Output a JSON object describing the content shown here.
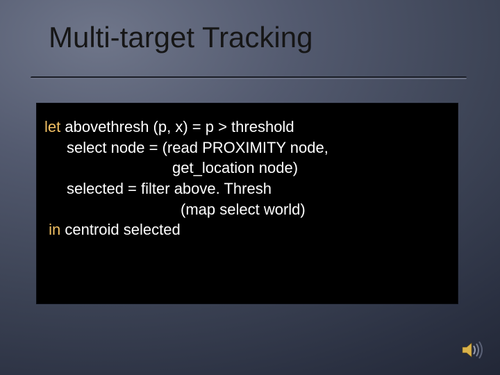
{
  "slide": {
    "title": "Multi-target Tracking",
    "code": {
      "kw_let": "let",
      "kw_in": "in",
      "l1_rest": " abovethresh (p, x) = p > threshold",
      "l2": "select node = (read PROXIMITY node,",
      "l3": "get_location node)",
      "l4": "selected = filter above. Thresh",
      "l5": "(map select world)",
      "l6_rest": " centroid selected"
    }
  },
  "icons": {
    "sound": "sound-icon"
  }
}
